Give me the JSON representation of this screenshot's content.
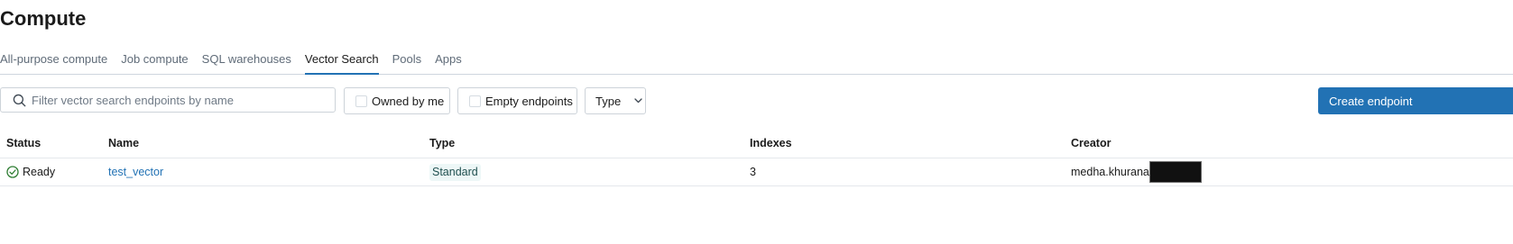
{
  "page": {
    "title": "Compute"
  },
  "tabs": [
    {
      "label": "All-purpose compute",
      "active": false
    },
    {
      "label": "Job compute",
      "active": false
    },
    {
      "label": "SQL warehouses",
      "active": false
    },
    {
      "label": "Vector Search",
      "active": true
    },
    {
      "label": "Pools",
      "active": false
    },
    {
      "label": "Apps",
      "active": false
    }
  ],
  "toolbar": {
    "search": {
      "placeholder": "Filter vector search endpoints by name",
      "value": "",
      "icon": "search-icon"
    },
    "owned_by_me": {
      "label": "Owned by me",
      "checked": false
    },
    "empty_endpoints": {
      "label": "Empty endpoints",
      "checked": false
    },
    "type_filter": {
      "label": "Type",
      "icon": "chevron-down-icon"
    },
    "create_button": {
      "label": "Create endpoint"
    }
  },
  "table": {
    "columns": [
      "Status",
      "Name",
      "Type",
      "Indexes",
      "Creator"
    ],
    "rows": [
      {
        "status": "Ready",
        "status_icon": "check-circle-icon",
        "name": "test_vector",
        "type": "Standard",
        "indexes": "3",
        "creator": "medha.khurana"
      }
    ]
  },
  "colors": {
    "accent": "#2272b4",
    "status_ready": "#2e7d32",
    "tag_bg": "#edf7f7",
    "redaction": "#111111"
  }
}
